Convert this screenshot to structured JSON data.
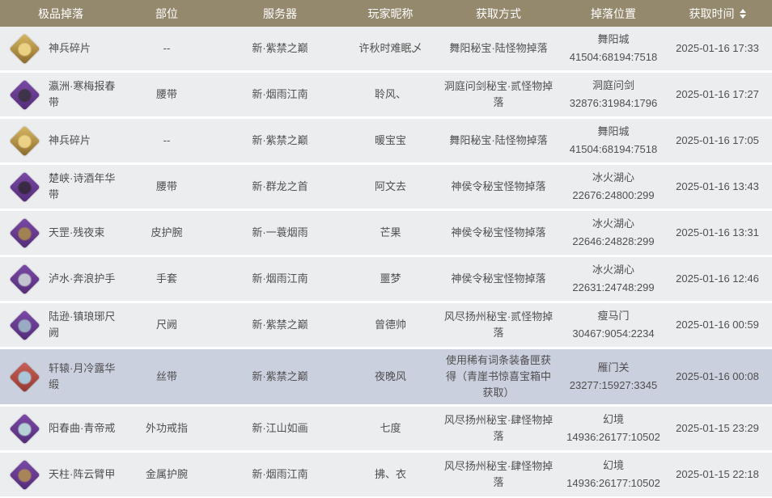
{
  "colors": {
    "header_bg": "#95896d",
    "header_text": "#ffffff",
    "row_bg": "#ebedef",
    "row_highlight_bg": "#cbd0de",
    "body_text": "#4f4f4f"
  },
  "header": {
    "columns": [
      {
        "label": "极品掉落"
      },
      {
        "label": "部位"
      },
      {
        "label": "服务器"
      },
      {
        "label": "玩家昵称"
      },
      {
        "label": "获取方式"
      },
      {
        "label": "掉落位置"
      },
      {
        "label": "获取时间"
      }
    ],
    "sort": {
      "column": "获取时间",
      "icon": "sort-arrows"
    }
  },
  "table": {
    "rows": [
      {
        "item": "神兵碎片",
        "part": "--",
        "server": "新·紫禁之巅",
        "player": "许秋时难眠乄",
        "method": "舞阳秘宝·陆怪物掉落",
        "location_name": "舞阳城",
        "location_coords": "41504:68194:7518",
        "time": "2025-01-16 17:33",
        "highlighted": false,
        "icon": {
          "shape": "gold-diamond",
          "from": "#d9b964",
          "to": "#8a6a2c",
          "inner": "#f2d98b"
        }
      },
      {
        "item": "瀛洲·寒梅报春带",
        "part": "腰带",
        "server": "新·烟雨江南",
        "player": "聆风、",
        "method": "洞庭问剑秘宝·贰怪物掉落",
        "location_name": "洞庭问剑",
        "location_coords": "32876:31984:1796",
        "time": "2025-01-16 17:27",
        "highlighted": false,
        "icon": {
          "shape": "purple-diamond",
          "from": "#7b4aa6",
          "to": "#532c78",
          "inner": "#3a3340"
        }
      },
      {
        "item": "神兵碎片",
        "part": "--",
        "server": "新·紫禁之巅",
        "player": "暖宝宝",
        "method": "舞阳秘宝·陆怪物掉落",
        "location_name": "舞阳城",
        "location_coords": "41504:68194:7518",
        "time": "2025-01-16 17:05",
        "highlighted": false,
        "icon": {
          "shape": "gold-diamond",
          "from": "#d9b964",
          "to": "#8a6a2c",
          "inner": "#f2d98b"
        }
      },
      {
        "item": "楚峡·诗酒年华带",
        "part": "腰带",
        "server": "新·群龙之首",
        "player": "阿文去",
        "method": "神侯令秘宝怪物掉落",
        "location_name": "冰火湖心",
        "location_coords": "22676:24800:299",
        "time": "2025-01-16 13:43",
        "highlighted": false,
        "icon": {
          "shape": "purple-diamond",
          "from": "#7b4aa6",
          "to": "#532c78",
          "inner": "#35283b"
        }
      },
      {
        "item": "天罡·残夜束",
        "part": "皮护腕",
        "server": "新·一蓑烟雨",
        "player": "芒果",
        "method": "神侯令秘宝怪物掉落",
        "location_name": "冰火湖心",
        "location_coords": "22646:24828:299",
        "time": "2025-01-16 13:31",
        "highlighted": false,
        "icon": {
          "shape": "purple-diamond",
          "from": "#7b4aa6",
          "to": "#532c78",
          "inner": "#a88a4e"
        }
      },
      {
        "item": "泸水·奔浪护手",
        "part": "手套",
        "server": "新·烟雨江南",
        "player": "噩梦",
        "method": "神侯令秘宝怪物掉落",
        "location_name": "冰火湖心",
        "location_coords": "22631:24748:299",
        "time": "2025-01-16 12:46",
        "highlighted": false,
        "icon": {
          "shape": "purple-diamond",
          "from": "#7b4aa6",
          "to": "#532c78",
          "inner": "#cfd3d8"
        }
      },
      {
        "item": "陆逊·镇琅琊尺阙",
        "part": "尺阙",
        "server": "新·紫禁之巅",
        "player": "曾德帅",
        "method": "风尽扬州秘宝·贰怪物掉落",
        "location_name": "瘦马门",
        "location_coords": "30467:9054:2234",
        "time": "2025-01-16 00:59",
        "highlighted": false,
        "icon": {
          "shape": "purple-diamond",
          "from": "#7b4aa6",
          "to": "#532c78",
          "inner": "#9fb8c9"
        }
      },
      {
        "item": "轩辕·月冷露华缎",
        "part": "丝带",
        "server": "新·紫禁之巅",
        "player": "夜晚风",
        "method": "使用稀有词条装备匣获得（青崖书惊喜宝箱中获取）",
        "location_name": "雁门关",
        "location_coords": "23277:15927:3345",
        "time": "2025-01-16 00:08",
        "highlighted": true,
        "icon": {
          "shape": "red-diamond",
          "from": "#c9625a",
          "to": "#93382f",
          "inner": "#a8d4e8"
        }
      },
      {
        "item": "阳春曲·青帝戒",
        "part": "外功戒指",
        "server": "新·江山如画",
        "player": "七度",
        "method": "风尽扬州秘宝·肆怪物掉落",
        "location_name": "幻境",
        "location_coords": "14936:26177:10502",
        "time": "2025-01-15 23:29",
        "highlighted": false,
        "icon": {
          "shape": "purple-diamond",
          "from": "#7b4aa6",
          "to": "#532c78",
          "inner": "#bfe3df"
        }
      },
      {
        "item": "天柱·阵云臂甲",
        "part": "金属护腕",
        "server": "新·烟雨江南",
        "player": "拂、衣",
        "method": "风尽扬州秘宝·肆怪物掉落",
        "location_name": "幻境",
        "location_coords": "14936:26177:10502",
        "time": "2025-01-15 22:18",
        "highlighted": false,
        "icon": {
          "shape": "purple-diamond",
          "from": "#7b4aa6",
          "to": "#532c78",
          "inner": "#b08d55"
        }
      }
    ]
  }
}
